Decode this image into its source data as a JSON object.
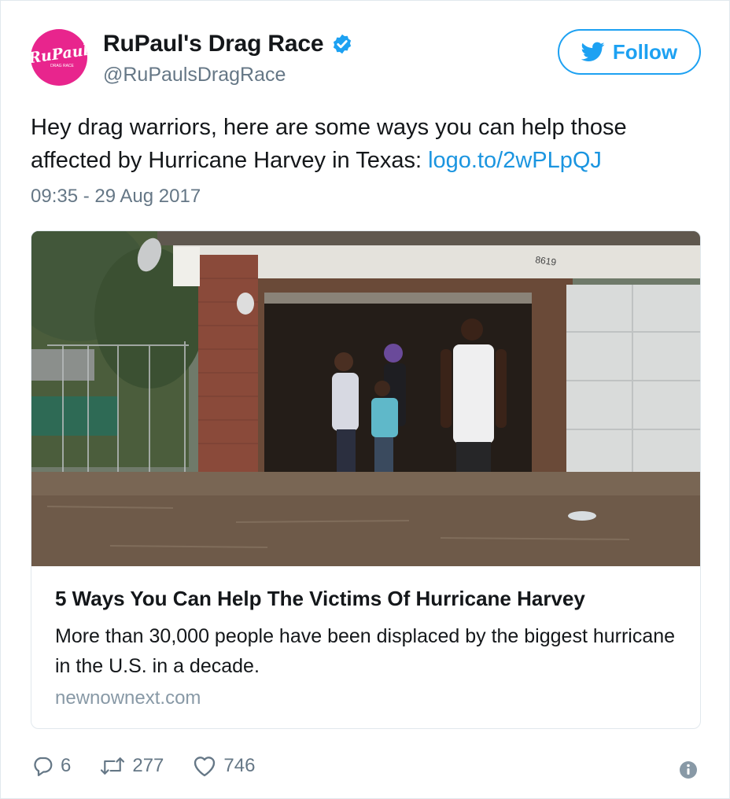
{
  "account": {
    "display_name": "RuPaul's Drag Race",
    "handle": "@RuPaulsDragRace",
    "avatar_logo_text": "RuPaul",
    "avatar_logo_subtext": "DRAG RACE",
    "verified": true
  },
  "follow_button": {
    "label": "Follow"
  },
  "tweet": {
    "text": "Hey drag warriors, here are some ways you can help those affected by Hurricane Harvey in Texas: ",
    "link": "logo.to/2wPLpQJ",
    "timestamp": "09:35 - 29 Aug 2017"
  },
  "card": {
    "image_house_number": "8619",
    "title": "5 Ways You Can Help The Victims Of Hurricane Harvey",
    "description": "More than 30,000 people have been displaced by the biggest hurricane in the U.S. in a decade.",
    "domain": "newnownext.com"
  },
  "actions": {
    "replies": "6",
    "retweets": "277",
    "likes": "746"
  },
  "colors": {
    "accent": "#1da1f2",
    "link": "#1b95e0",
    "muted": "#657786",
    "avatar_bg": "#e8258d"
  },
  "icons": [
    "verified-badge-icon",
    "twitter-bird-icon",
    "reply-icon",
    "retweet-icon",
    "like-icon",
    "info-icon"
  ]
}
